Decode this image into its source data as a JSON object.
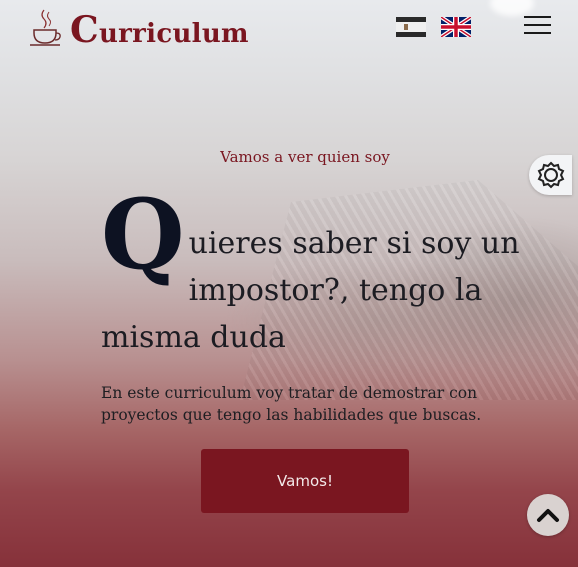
{
  "header": {
    "logo_initial": "C",
    "logo_rest": "urriculum",
    "language_flags": [
      "spain-flag-icon",
      "uk-flag-icon"
    ],
    "menu_icon": "hamburger-menu-icon"
  },
  "theme_toggle": {
    "icon": "brightness-icon"
  },
  "hero": {
    "subtitle": "Vamos a ver quien soy",
    "headline_initial": "Q",
    "headline_line1": "uieres saber si soy un",
    "headline_rest": "impostor?, tengo la misma duda",
    "description": "En este curriculum voy tratar de demostrar con proyectos que tengo las habilidades que buscas.",
    "cta_label": "Vamos!"
  },
  "scroll_top": {
    "icon": "chevron-up-icon"
  },
  "colors": {
    "accent": "#7a1620",
    "text": "#1c1c22"
  }
}
